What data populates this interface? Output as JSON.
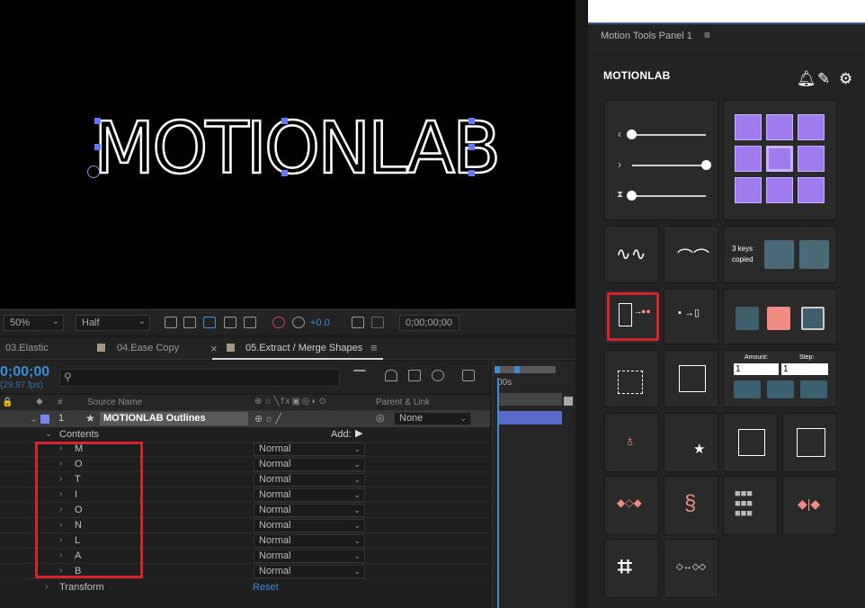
{
  "viewer": {
    "title": "MOTIONLAB"
  },
  "viewer_bar": {
    "zoom": "50%",
    "resolution": "Half",
    "exposure": "+0.0",
    "timecode": "0;00;00;00"
  },
  "tabs": [
    {
      "label": "03.Elastic"
    },
    {
      "label": "04.Ease Copy"
    },
    {
      "label": "05.Extract / Merge Shapes",
      "menu": "≡",
      "close": "×"
    }
  ],
  "timeline": {
    "timecode": "0;00;00",
    "fps": "(29.97 fps)",
    "ruler_label": "00s"
  },
  "columns": {
    "hash": "#",
    "source_name": "Source Name",
    "parent_link": "Parent & Link"
  },
  "layer": {
    "index": "1",
    "name": "MOTIONLAB Outlines",
    "parent": "None"
  },
  "contents": {
    "label": "Contents",
    "add_label": "Add:"
  },
  "sublayers": [
    {
      "name": "M",
      "mode": "Normal"
    },
    {
      "name": "O",
      "mode": "Normal"
    },
    {
      "name": "T",
      "mode": "Normal"
    },
    {
      "name": "I",
      "mode": "Normal"
    },
    {
      "name": "O",
      "mode": "Normal"
    },
    {
      "name": "N",
      "mode": "Normal"
    },
    {
      "name": "L",
      "mode": "Normal"
    },
    {
      "name": "A",
      "mode": "Normal"
    },
    {
      "name": "B",
      "mode": "Normal"
    }
  ],
  "transform": {
    "label": "Transform",
    "reset": "Reset"
  },
  "panel": {
    "header": "Motion Tools Panel 1",
    "menu": "≡",
    "brand": "MOTIONLAB",
    "keys_copied": "3 keys copied",
    "amount_label": "Amount:",
    "step_label": "Step:",
    "amount_value": "1",
    "step_value": "1"
  },
  "colors": {
    "accent": "#3b8bd9",
    "highlight": "#d9222a",
    "grid": "#a07cf0",
    "coral": "#f28b82"
  }
}
